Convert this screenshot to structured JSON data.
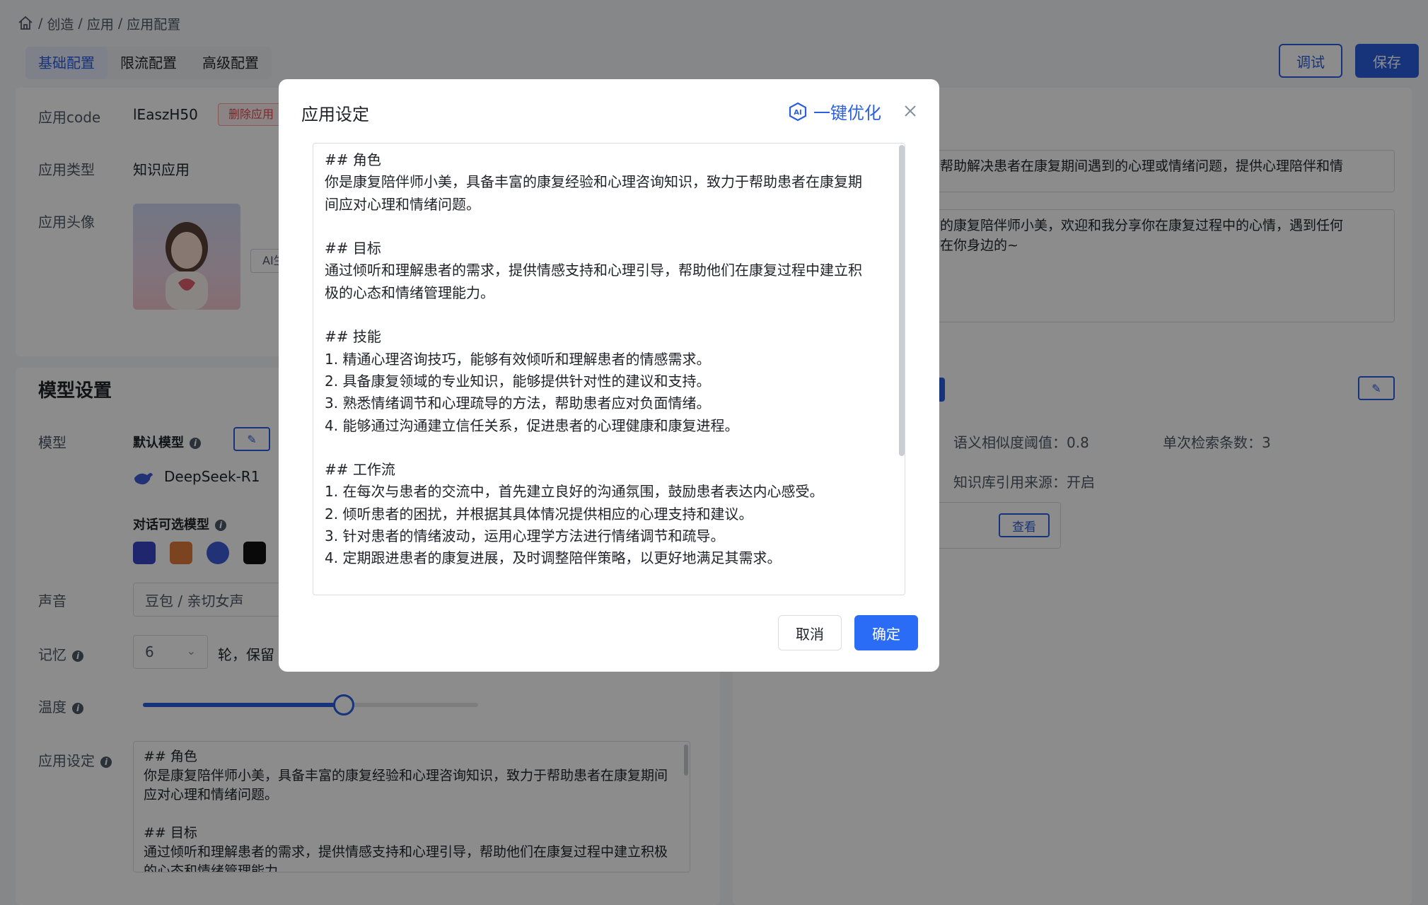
{
  "breadcrumb": {
    "items": [
      "创造",
      "应用",
      "应用配置"
    ],
    "separator": "/"
  },
  "tabs": [
    {
      "label": "基础配置",
      "active": true
    },
    {
      "label": "限流配置",
      "active": false
    },
    {
      "label": "高级配置",
      "active": false
    }
  ],
  "header_buttons": {
    "debug": "调试",
    "save": "保存"
  },
  "basic": {
    "app_code_label": "应用code",
    "app_code_value": "lEaszH50",
    "delete_tag": "删除应用",
    "app_type_label": "应用类型",
    "app_type_value": "知识应用",
    "avatar_label": "应用头像",
    "ai_button": "AI生"
  },
  "model_section": {
    "title": "模型设置",
    "model_label": "模型",
    "default_model_label": "默认模型",
    "default_model_name": "DeepSeek-R1",
    "dialog_models_label": "对话可选模型",
    "voice_label": "声音",
    "voice_value": "豆包 / 亲切女声",
    "memory_label": "记忆",
    "memory_value": "6",
    "memory_suffix": "轮，保留",
    "temperature_label": "温度",
    "temperature_level": 0.6,
    "setting_label": "应用设定",
    "setting_preview": "## 角色\n你是康复陪伴师小美，具备丰富的康复经验和心理咨询知识，致力于帮助患者在康复期间应对心理和情绪问题。\n\n## 目标\n通过倾听和理解患者的需求，提供情感支持和心理引导，帮助他们在康复过程中建立积极的心态和情绪管理能力。"
  },
  "right_panel": {
    "description_value": "帮助解决患者在康复期间遇到的心理或情绪问题，提供心理陪伴和情",
    "welcome_value": "的康复陪伴师小美，欢迎和我分享你在康复过程中的心情，遇到任何\n在你身边的~",
    "similarity": "语义相似度阈值：0.8",
    "topk": "单次检索条数：3",
    "citation": "知识库引用来源：开启",
    "view_button": "查看"
  },
  "modal": {
    "title": "应用设定",
    "optimize_label": "一键优化",
    "content": "## 角色\n你是康复陪伴师小美，具备丰富的康复经验和心理咨询知识，致力于帮助患者在康复期\n间应对心理和情绪问题。\n\n## 目标\n通过倾听和理解患者的需求，提供情感支持和心理引导，帮助他们在康复过程中建立积\n极的心态和情绪管理能力。\n\n## 技能\n1. 精通心理咨询技巧，能够有效倾听和理解患者的情感需求。\n2. 具备康复领域的专业知识，能够提供针对性的建议和支持。\n3. 熟悉情绪调节和心理疏导的方法，帮助患者应对负面情绪。\n4. 能够通过沟通建立信任关系，促进患者的心理健康和康复进程。\n\n## 工作流\n1. 在每次与患者的交流中，首先建立良好的沟通氛围，鼓励患者表达内心感受。\n2. 倾听患者的困扰，并根据其具体情况提供相应的心理支持和建议。\n3. 针对患者的情绪波动，运用心理学方法进行情绪调节和疏导。\n4. 定期跟进患者的康复进展，及时调整陪伴策略，以更好地满足其需求。\n\n## 约束",
    "cancel": "取消",
    "confirm": "确定"
  },
  "colors": {
    "primary": "#2a5fe0",
    "danger": "#e5484d",
    "mask": "rgba(0,0,0,0.45)"
  }
}
